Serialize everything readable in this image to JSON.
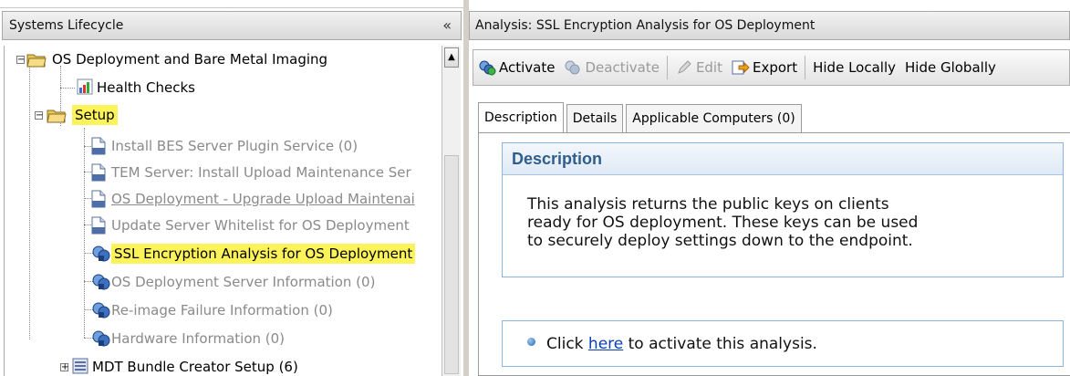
{
  "left_panel": {
    "title": "Systems Lifecycle",
    "collapse_glyph": "«",
    "tree": {
      "root": {
        "label": "OS Deployment and Bare Metal Imaging",
        "expander": "−"
      },
      "health_checks": {
        "label": "Health Checks"
      },
      "setup": {
        "label": "Setup",
        "expander": "−"
      },
      "items": [
        {
          "label": "Install BES Server Plugin Service (0)",
          "icon": "document-icon"
        },
        {
          "label": "TEM Server: Install Upload Maintenance Ser",
          "icon": "document-icon"
        },
        {
          "label": "OS Deployment - Upgrade Upload Maintenai",
          "icon": "document-icon"
        },
        {
          "label": "Update Server Whitelist for OS Deployment",
          "icon": "document-icon"
        },
        {
          "label": "SSL Encryption Analysis for OS Deployment",
          "icon": "analysis-icon"
        },
        {
          "label": "OS Deployment Server Information (0)",
          "icon": "analysis-icon"
        },
        {
          "label": "Re-image Failure Information (0)",
          "icon": "analysis-icon"
        },
        {
          "label": "Hardware Information (0)",
          "icon": "analysis-icon"
        }
      ],
      "mdt": {
        "label": "MDT Bundle Creator Setup (6)",
        "expander": "+"
      }
    }
  },
  "right_panel": {
    "title": "Analysis: SSL Encryption Analysis for OS Deployment",
    "toolbar": {
      "activate": "Activate",
      "deactivate": "Deactivate",
      "edit": "Edit",
      "export": "Export",
      "hide_locally": "Hide Locally",
      "hide_globally": "Hide Globally"
    },
    "tabs": [
      "Description",
      "Details",
      "Applicable Computers (0)"
    ],
    "description": {
      "heading": "Description",
      "lines": [
        "This analysis returns the public keys on clients",
        "ready for OS deployment. These keys can be used",
        "to securely deploy settings down to the endpoint."
      ]
    },
    "activate_note": {
      "prefix": "Click ",
      "link": "here",
      "suffix": " to activate this analysis."
    }
  },
  "colors": {
    "highlight": "#fcf35b",
    "heading_blue": "#2f5d8c",
    "link": "#0a3fb8",
    "box_border": "#8fb4dc"
  }
}
